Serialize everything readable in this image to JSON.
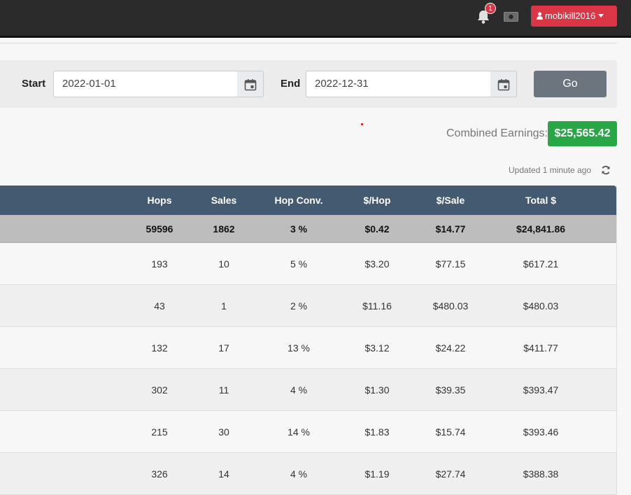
{
  "topbar": {
    "notification_count": "1",
    "user_label": "mobikill2016",
    "icons": [
      "bell-icon",
      "money-icon",
      "user-icon",
      "caret-down-icon"
    ]
  },
  "filters": {
    "start_label": "Start",
    "start_value": "2022-01-01",
    "end_label": "End",
    "end_value": "2022-12-31",
    "go_label": "Go"
  },
  "earnings": {
    "label": "Combined Earnings:",
    "value": "$25,565.42",
    "badge_color": "#28a745"
  },
  "updated": {
    "text": "Updated 1 minute ago"
  },
  "table": {
    "headers": [
      "Hops",
      "Sales",
      "Hop Conv.",
      "$/Hop",
      "$/Sale",
      "Total $"
    ],
    "totals": [
      "59596",
      "1862",
      "3 %",
      "$0.42",
      "$14.77",
      "$24,841.86"
    ],
    "rows": [
      [
        "193",
        "10",
        "5 %",
        "$3.20",
        "$77.15",
        "$617.21"
      ],
      [
        "43",
        "1",
        "2 %",
        "$11.16",
        "$480.03",
        "$480.03"
      ],
      [
        "132",
        "17",
        "13 %",
        "$3.12",
        "$24.22",
        "$411.77"
      ],
      [
        "302",
        "11",
        "4 %",
        "$1.30",
        "$39.35",
        "$393.47"
      ],
      [
        "215",
        "30",
        "14 %",
        "$1.83",
        "$15.74",
        "$393.46"
      ],
      [
        "326",
        "14",
        "4 %",
        "$1.19",
        "$27.74",
        "$388.38"
      ]
    ],
    "header_color": "#435a70"
  }
}
